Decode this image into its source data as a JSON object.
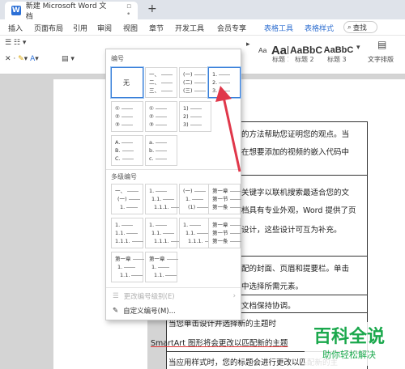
{
  "title_bar": {
    "doc_tab": "新建 Microsoft Word 文档",
    "add_tab": "+",
    "tab_controls": "▫ •"
  },
  "ribbon_tabs": [
    "插入",
    "页面布局",
    "引用",
    "审阅",
    "视图",
    "章节",
    "开发工具",
    "会员专享",
    "表格工具",
    "表格样式"
  ],
  "search": "查找",
  "toolbar": {
    "styles": [
      {
        "preview": "AaBbCcDd",
        "label": ""
      },
      {
        "preview": "AaBb",
        "label": "标题 1"
      },
      {
        "preview": "AaBbC",
        "label": "标题 2"
      },
      {
        "preview": "AaBbC",
        "label": "标题 3"
      }
    ],
    "text_layout": "文字排版"
  },
  "document": {
    "lines": [
      "的方法帮助您证明您的观点。当",
      "在想要添加的视频的嵌入代码中",
      "关键字以联机搜索最适合您的文",
      "档具有专业外观，Word 提供了页",
      "设计，这些设计可互为补充。",
      "配的封面、页眉和提要栏。单击",
      "中选择所需元素。",
      "文档保持协调。",
      "当您单击设计并选择新的主题时",
      "SmartArt 图形将会更改以匹配新的主题",
      "当应用样式时，您的标题会进行更改以匹配新的主"
    ]
  },
  "dropdown": {
    "header": "编号",
    "none_label": "无",
    "numbering_tiles": [
      [
        "一、",
        "二、",
        "三、"
      ],
      [
        "(一)",
        "(二)",
        "(三)"
      ],
      [
        "1.",
        "2.",
        "3."
      ],
      [
        "①",
        "②",
        "③"
      ],
      [
        "①",
        "②",
        "③"
      ],
      [
        "1)",
        "2)",
        "3)"
      ],
      [
        "A.",
        "B.",
        "C."
      ],
      [
        "a.",
        "b.",
        "c."
      ]
    ],
    "multilevel_header": "多级编号",
    "multilevel_tiles": [
      [
        "一、",
        "(一)",
        "1."
      ],
      [
        "1.",
        "1.1.",
        "1.1.1."
      ],
      [
        "(一)",
        "1.",
        "(1)"
      ],
      [
        "第一章",
        "第一节",
        "第一条"
      ],
      [
        "1.",
        "1.1.",
        "1.1.1."
      ],
      [
        "1.",
        "1.1.",
        "1.1.1."
      ],
      [
        "1.",
        "1.1.",
        "1.1.1."
      ],
      [
        "第一章",
        "第一节",
        "第一条"
      ],
      [
        "第一章",
        "1.",
        "1.1."
      ],
      [
        "第一章",
        "1.",
        "1.1."
      ]
    ],
    "change_level": "更改编号级别(E)",
    "custom": "自定义编号(M)..."
  },
  "watermark": {
    "title": "百科全说",
    "subtitle": "助你轻松解决"
  },
  "colors": {
    "accent": "#2f6fd0",
    "arrow": "#e0374a",
    "watermark": "#1aa84c"
  }
}
